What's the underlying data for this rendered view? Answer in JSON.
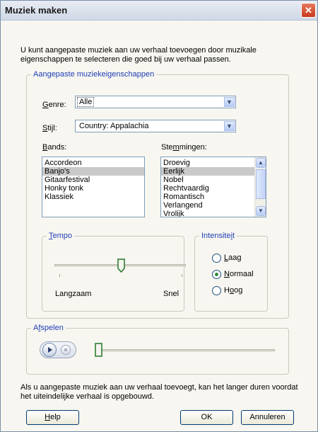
{
  "window": {
    "title": "Muziek maken"
  },
  "intro": "U kunt aangepaste muziek aan uw verhaal toevoegen door muzikale eigenschappen te selecteren die goed bij uw verhaal passen.",
  "custom_group": {
    "legend": "Aangepaste muziekeigenschappen",
    "genre": {
      "label_u": "G",
      "label_rest": "enre:",
      "value": "Alle"
    },
    "stijl": {
      "label_u": "S",
      "label_rest": "tijl:",
      "value": "Country: Appalachia"
    },
    "bands": {
      "label_u": "B",
      "label_rest": "ands:",
      "items": [
        "Accordeon",
        "Banjo's",
        "Gitaarfestival",
        "Honky tonk",
        "Klassiek"
      ],
      "selected_index": 1
    },
    "stemmingen": {
      "label_pre": "Ste",
      "label_u": "m",
      "label_rest": "mingen:",
      "items": [
        "Droevig",
        "Eerlijk",
        "Nobel",
        "Rechtvaardig",
        "Romantisch",
        "Verlangend",
        "Vrolijk"
      ],
      "selected_index": 1
    },
    "tempo": {
      "legend_u": "T",
      "legend_rest": "empo",
      "min_label": "Langzaam",
      "max_label": "Snel",
      "level": 0.5
    },
    "intensiteit": {
      "legend_pre": "Intensite",
      "legend_u": "i",
      "legend_rest": "t",
      "options": [
        {
          "u": "L",
          "rest": "aag",
          "checked": false
        },
        {
          "u": "N",
          "rest": "ormaal",
          "checked": true
        },
        {
          "pre": "H",
          "u": "o",
          "rest": "og",
          "checked": false
        }
      ]
    }
  },
  "afspelen": {
    "legend_pre": "A",
    "legend_u": "f",
    "legend_rest": "spelen",
    "position": 0
  },
  "footer_note": "Als u aangepaste muziek aan uw verhaal toevoegt, kan het langer duren voordat het uiteindelijke verhaal is opgebouwd.",
  "buttons": {
    "help_u": "H",
    "help_rest": "elp",
    "ok": "OK",
    "cancel": "Annuleren"
  },
  "colors": {
    "legend": "#1f3fb6",
    "selection": "#c9c9c9",
    "radio_dot": "#2f8a3a",
    "close": "#c8381a"
  }
}
